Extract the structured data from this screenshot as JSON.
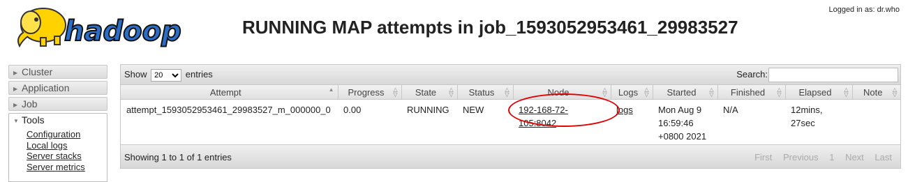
{
  "header": {
    "logged_in": "Logged in as: dr.who",
    "logo_text": "hadoop",
    "title": "RUNNING MAP attempts in job_1593052953461_29983527"
  },
  "sidebar": {
    "items": [
      {
        "label": "Cluster",
        "icon": "triangle-right-icon"
      },
      {
        "label": "Application",
        "icon": "triangle-right-icon"
      },
      {
        "label": "Job",
        "icon": "triangle-right-icon"
      },
      {
        "label": "Tools",
        "icon": "triangle-down-icon"
      }
    ],
    "tools_links": [
      "Configuration",
      "Local logs",
      "Server stacks",
      "Server metrics"
    ]
  },
  "controls": {
    "show_label": "Show",
    "entries_value": "20",
    "entries_label": "entries",
    "search_label": "Search:",
    "search_value": ""
  },
  "table": {
    "columns": [
      "Attempt",
      "Progress",
      "State",
      "Status",
      "Node",
      "Logs",
      "Started",
      "Finished",
      "Elapsed",
      "Note"
    ],
    "rows": [
      {
        "attempt": "attempt_1593052953461_29983527_m_000000_0",
        "progress": "0.00",
        "state": "RUNNING",
        "status": "NEW",
        "node": "192-168-72-105:8042",
        "logs": "logs",
        "started": "Mon Aug 9 16:59:46 +0800 2021",
        "finished": "N/A",
        "elapsed": "12mins, 27sec",
        "note": ""
      }
    ]
  },
  "footer": {
    "info": "Showing 1 to 1 of 1 entries",
    "paginate": [
      "First",
      "Previous",
      "1",
      "Next",
      "Last"
    ]
  },
  "colors": {
    "annotation_circle": "#e00000",
    "logo_yellow": "#ffd200",
    "logo_blue": "#2a6ec8"
  }
}
